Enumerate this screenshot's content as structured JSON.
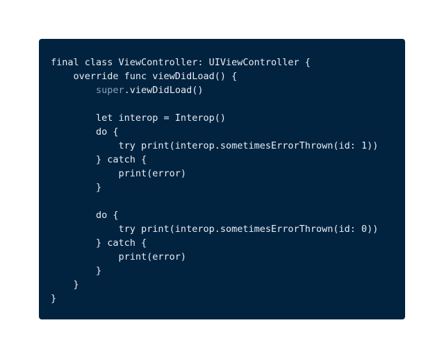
{
  "colors": {
    "page_background": "#ffffff",
    "panel_background": "#012340",
    "text": "#e8edf2",
    "keyword_super": "#8aa3b8"
  },
  "code": {
    "language": "swift",
    "lines": [
      [
        {
          "t": "final class ViewController: UIViewController {",
          "k": "plain"
        }
      ],
      [
        {
          "t": "    override func viewDidLoad() {",
          "k": "plain"
        }
      ],
      [
        {
          "t": "        ",
          "k": "plain"
        },
        {
          "t": "super",
          "k": "super"
        },
        {
          "t": ".viewDidLoad()",
          "k": "plain"
        }
      ],
      [
        {
          "t": "",
          "k": "plain"
        }
      ],
      [
        {
          "t": "        let interop = Interop()",
          "k": "plain"
        }
      ],
      [
        {
          "t": "        do {",
          "k": "plain"
        }
      ],
      [
        {
          "t": "            try print(interop.sometimesErrorThrown(id: ",
          "k": "plain"
        },
        {
          "t": "1",
          "k": "number"
        },
        {
          "t": "))",
          "k": "plain"
        }
      ],
      [
        {
          "t": "        } catch {",
          "k": "plain"
        }
      ],
      [
        {
          "t": "            print(error)",
          "k": "plain"
        }
      ],
      [
        {
          "t": "        }",
          "k": "plain"
        }
      ],
      [
        {
          "t": "",
          "k": "plain"
        }
      ],
      [
        {
          "t": "        do {",
          "k": "plain"
        }
      ],
      [
        {
          "t": "            try print(interop.sometimesErrorThrown(id: ",
          "k": "plain"
        },
        {
          "t": "0",
          "k": "number"
        },
        {
          "t": "))",
          "k": "plain"
        }
      ],
      [
        {
          "t": "        } catch {",
          "k": "plain"
        }
      ],
      [
        {
          "t": "            print(error)",
          "k": "plain"
        }
      ],
      [
        {
          "t": "        }",
          "k": "plain"
        }
      ],
      [
        {
          "t": "    }",
          "k": "plain"
        }
      ],
      [
        {
          "t": "}",
          "k": "plain"
        }
      ]
    ]
  }
}
